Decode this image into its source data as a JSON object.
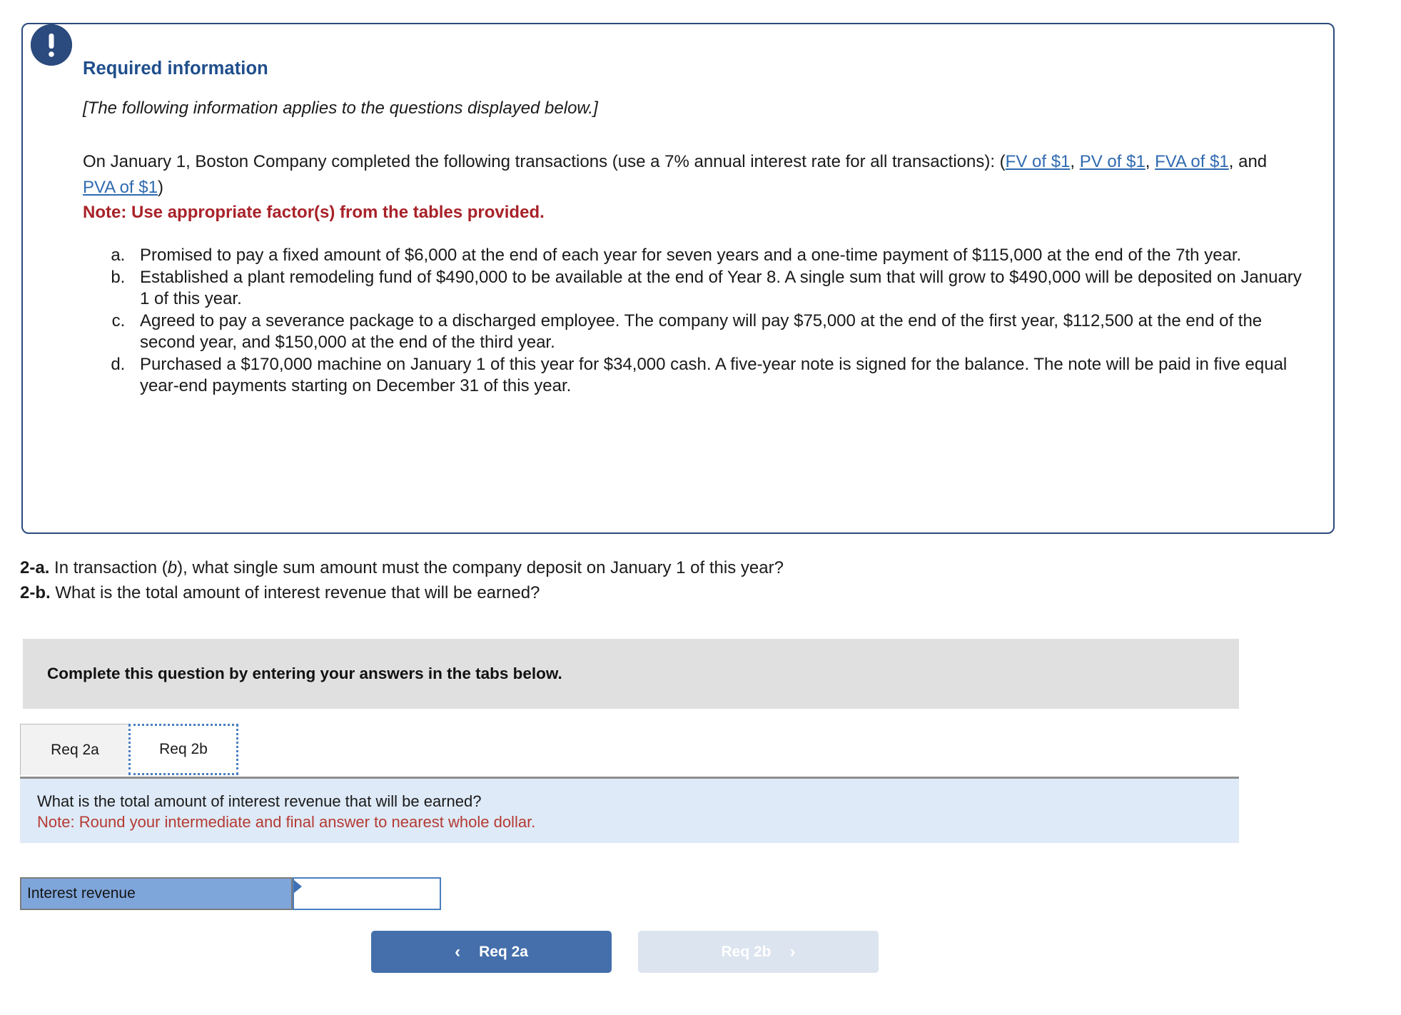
{
  "required_info": {
    "icon": "exclamation-circle-icon",
    "title": "Required information",
    "applies_note": "[The following information applies to the questions displayed below.]",
    "intro_prefix": "On January 1, Boston Company completed the following transactions (use a 7% annual interest rate for all transactions): (",
    "links": [
      {
        "label": "FV of $1"
      },
      {
        "label": "PV of $1"
      },
      {
        "label": "FVA of $1"
      },
      {
        "label": "PVA of $1"
      }
    ],
    "link_sep_1": ", ",
    "link_sep_2": ", ",
    "link_sep_3": ", and ",
    "intro_suffix": ")",
    "note": "Note: Use appropriate factor(s) from the tables provided.",
    "transactions": [
      "Promised to pay a fixed amount of $6,000 at the end of each year for seven years and a one-time payment of $115,000 at the end of the 7th year.",
      "Established a plant remodeling fund of $490,000 to be available at the end of Year 8. A single sum that will grow to $490,000 will be deposited on January 1 of this year.",
      "Agreed to pay a severance package to a discharged employee. The company will pay $75,000 at the end of the first year, $112,500 at the end of the second year, and $150,000 at the end of the third year.",
      "Purchased a $170,000 machine on January 1 of this year for $34,000 cash. A five-year note is signed for the balance. The note will be paid in five equal year-end payments starting on December 31 of this year."
    ]
  },
  "questions": [
    {
      "label": "2-a.",
      "text_before_italic": " In transaction (",
      "italic": "b",
      "text_after_italic": "), what single sum amount must the company deposit on January 1 of this year?"
    },
    {
      "label": "2-b.",
      "text": " What is the total amount of interest revenue that will be earned?"
    }
  ],
  "instruction_bar": {
    "text": "Complete this question by entering your answers in the tabs below."
  },
  "tabs": [
    {
      "label": "Req 2a",
      "active": false
    },
    {
      "label": "Req 2b",
      "active": true
    }
  ],
  "answer_panel": {
    "question": "What is the total amount of interest revenue that will be earned?",
    "note": "Note: Round your intermediate and final answer to nearest whole dollar."
  },
  "answer_row": {
    "label": "Interest revenue",
    "value": "",
    "placeholder": ""
  },
  "nav": {
    "prev_label": "Req 2a",
    "prev_icon": "chevron-left-icon",
    "next_label": "Req 2b",
    "next_icon": "chevron-right-icon"
  },
  "colors": {
    "panel_border": "#2b4a7d",
    "panel_title": "#1f4e8c",
    "link": "#2f6ab0",
    "note_red": "#a82229",
    "instruction_gray": "#e0e0e0",
    "answer_panel_blue": "#deeaf7",
    "answer_note_red": "#b53a33",
    "label_cell_blue": "#7fa6db",
    "primary_button": "#446fab",
    "disabled_button": "#dce4ef"
  }
}
